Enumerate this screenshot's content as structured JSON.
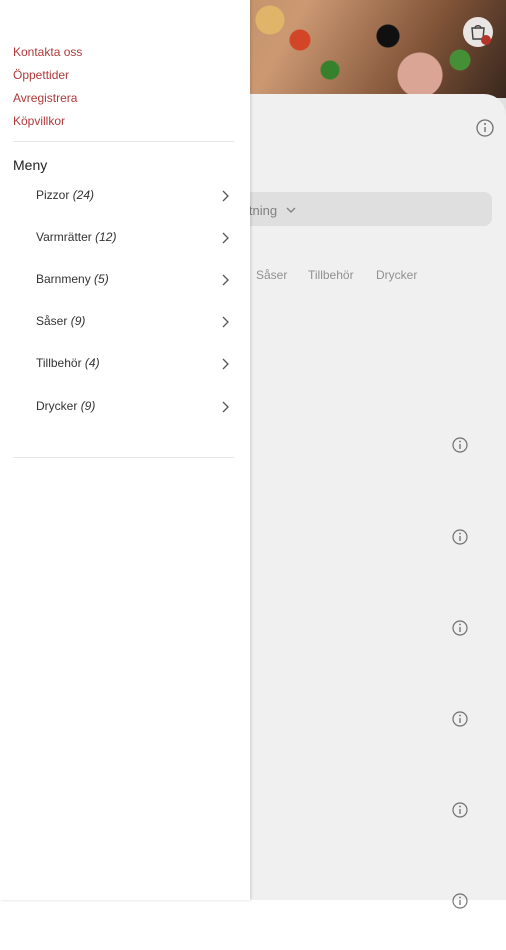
{
  "drawer": {
    "links": [
      "Kontakta oss",
      "Öppettider",
      "Avregistrera",
      "Köpvillkor"
    ],
    "menu_heading": "Meny",
    "items": [
      {
        "label": "Pizzor",
        "count": "(24)"
      },
      {
        "label": "Varmrätter",
        "count": "(12)"
      },
      {
        "label": "Barnmeny",
        "count": "(5)"
      },
      {
        "label": "Såser",
        "count": "(9)"
      },
      {
        "label": "Tillbehör",
        "count": "(4)"
      },
      {
        "label": "Drycker",
        "count": "(9)"
      }
    ]
  },
  "background": {
    "sort_label": "ltning",
    "category_tabs": [
      "Såser",
      "Tillbehör",
      "Drycker"
    ]
  },
  "icons": {
    "cart": "cart-icon",
    "info": "info-icon",
    "chevron": "chevron-right-icon",
    "dropdown": "chevron-down-icon"
  },
  "colors": {
    "accent": "#b0393a",
    "badge": "#c0392b"
  }
}
